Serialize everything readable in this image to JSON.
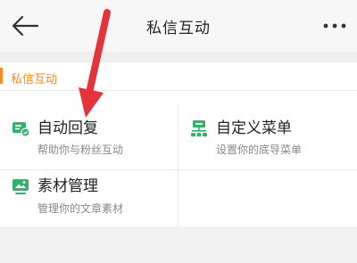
{
  "header": {
    "title": "私信互动",
    "back_icon": "back-arrow-icon",
    "more_icon": "more-dots-icon"
  },
  "section": {
    "label": "私信互动",
    "accent_color": "#ff8a1a"
  },
  "items": [
    {
      "name": "自动回复",
      "desc": "帮助你与粉丝互动",
      "icon": "auto-reply-icon",
      "icon_color": "#2fb36b"
    },
    {
      "name": "自定义菜单",
      "desc": "设置你的底导菜单",
      "icon": "custom-menu-icon",
      "icon_color": "#2fb36b"
    },
    {
      "name": "素材管理",
      "desc": "管理你的文章素材",
      "icon": "material-icon",
      "icon_color": "#2fb36b"
    }
  ],
  "annotation": {
    "color": "#e5333b",
    "icon": "pointer-arrow"
  }
}
